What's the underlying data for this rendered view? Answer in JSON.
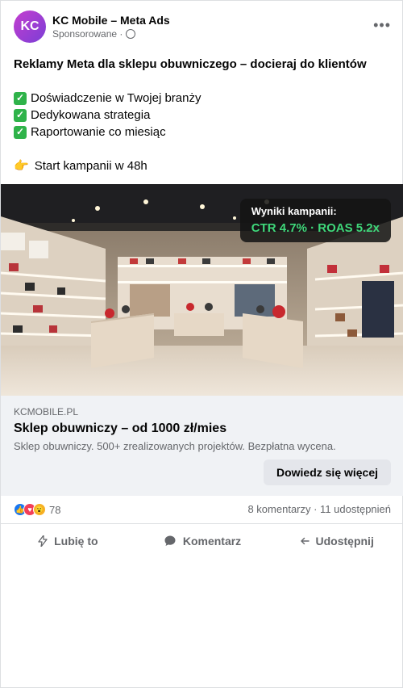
{
  "post": {
    "page_name": "KC Mobile – Meta Ads",
    "avatar_initials": "KC",
    "sponsored_label": "Sponsorowane ·",
    "more_label": "•••",
    "headline": "Reklamy Meta dla sklepu obuwniczego – docieraj do klientów",
    "bullets": [
      "Doświadczenie w Twojej branży",
      "Dedykowana strategia",
      "Raportowanie co miesiąc"
    ],
    "cta_line": "Start kampanii w 48h"
  },
  "media_overlay": {
    "title": "Wyniki kampanii:",
    "value": "CTR 4.7% · ROAS 5.2x"
  },
  "link_preview": {
    "domain": "KCMOBILE.PL",
    "title": "Sklep obuwniczy – od 1000 zł/mies",
    "description": "Sklep obuwniczy. 500+ zrealizowanych projektów. Bezpłatna wycena.",
    "cta_label": "Dowiedz się więcej"
  },
  "engagement": {
    "reaction_count": "78",
    "comments_shares": "8 komentarzy · 11 udostępnień"
  },
  "actions": {
    "like": "Lubię to",
    "comment": "Komentarz",
    "share": "Udostępnij"
  },
  "colors": {
    "avatar_gradient_start": "#c43dcf",
    "avatar_gradient_end": "#7b3fd6",
    "overlay_value": "#3fd87a",
    "check_green": "#2fb34a",
    "like_blue": "#1877f2"
  }
}
